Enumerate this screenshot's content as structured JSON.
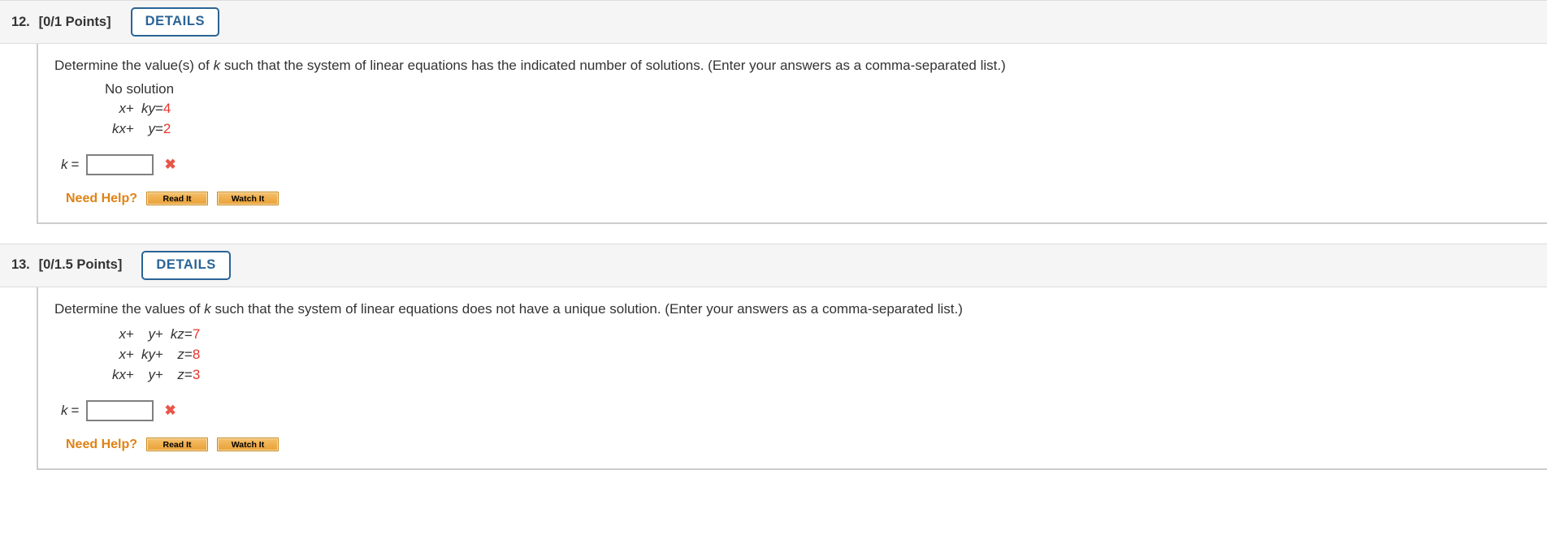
{
  "questions": [
    {
      "number": "12.",
      "points": "[0/1 Points]",
      "details_label": "DETAILS",
      "prompt_pre": "Determine the value(s) of ",
      "prompt_var": "k",
      "prompt_post": " such that the system of linear equations has the indicated number of solutions. (Enter your answers as a comma-separated list.)",
      "solution_label": "No solution",
      "equations": [
        {
          "t1": "x",
          "op1": "+",
          "t2": "ky",
          "eq": "=",
          "rhs": "4"
        },
        {
          "t1": "kx",
          "op1": "+",
          "t2": "y",
          "eq": "=",
          "rhs": "2"
        }
      ],
      "answer": {
        "variable": "k",
        "equals": "=",
        "value": "",
        "placeholder": "",
        "status_mark": "✖"
      },
      "help": {
        "label": "Need Help?",
        "buttons": [
          {
            "label": "Read It"
          },
          {
            "label": "Watch It"
          }
        ]
      }
    },
    {
      "number": "13.",
      "points": "[0/1.5 Points]",
      "details_label": "DETAILS",
      "prompt_pre": "Determine the values of ",
      "prompt_var": "k",
      "prompt_post": " such that the system of linear equations does not have a unique solution. (Enter your answers as a comma-separated list.)",
      "solution_label": "",
      "equations": [
        {
          "t1": "x",
          "op1": "+",
          "t2": "y",
          "op2": "+",
          "t3": "kz",
          "eq": "=",
          "rhs": "7"
        },
        {
          "t1": "x",
          "op1": "+",
          "t2": "ky",
          "op2": "+",
          "t3": "z",
          "eq": "=",
          "rhs": "8"
        },
        {
          "t1": "kx",
          "op1": "+",
          "t2": "y",
          "op2": "+",
          "t3": "z",
          "eq": "=",
          "rhs": "3"
        }
      ],
      "answer": {
        "variable": "k",
        "equals": "=",
        "value": "",
        "placeholder": "",
        "status_mark": "✖"
      },
      "help": {
        "label": "Need Help?",
        "buttons": [
          {
            "label": "Read It"
          },
          {
            "label": "Watch It"
          }
        ]
      }
    }
  ],
  "colors": {
    "rhs_red": "#e8342a",
    "incorrect_red": "#e8564a",
    "details_blue": "#2a6496",
    "need_help_orange": "#e08214",
    "help_button_orange": "#efaf4e",
    "header_bg": "#f5f5f5"
  }
}
